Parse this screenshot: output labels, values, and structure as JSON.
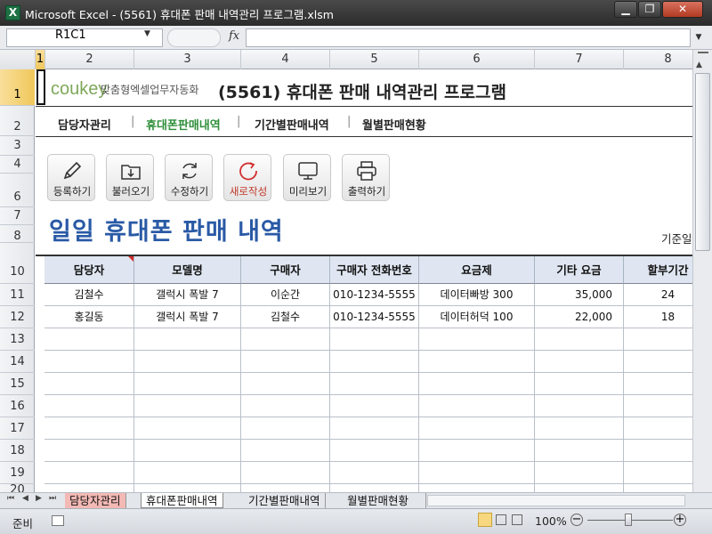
{
  "window": {
    "title": "Microsoft Excel - (5561) 휴대폰 판매 내역관리 프로그램.xlsm",
    "app_icon": "X",
    "minimize": "▁",
    "maximize": "❐",
    "close": "✕"
  },
  "formula_bar": {
    "name_box": "R1C1",
    "fx": "fx",
    "value": ""
  },
  "columns": [
    "1",
    "2",
    "3",
    "4",
    "5",
    "6",
    "7",
    "8"
  ],
  "rows": [
    "1",
    "2",
    "3",
    "4",
    "6",
    "7",
    "8",
    "10",
    "11",
    "12",
    "13",
    "14",
    "15",
    "16",
    "17",
    "18",
    "19",
    "20"
  ],
  "header": {
    "logo": "coukey",
    "tagline": "맞춤형엑셀업무자동화",
    "title": "(5561) 휴대폰 판매 내역관리 프로그램"
  },
  "nav": [
    "담당자관리",
    "휴대폰판매내역",
    "기간별판매내역",
    "월별판매현황"
  ],
  "nav_separator": "|",
  "toolbar": [
    {
      "label": "등록하기",
      "icon": "pencil-icon"
    },
    {
      "label": "불러오기",
      "icon": "folder-download-icon"
    },
    {
      "label": "수정하기",
      "icon": "refresh-icon"
    },
    {
      "label": "새로작성",
      "icon": "new-circle-icon"
    },
    {
      "label": "미리보기",
      "icon": "monitor-icon"
    },
    {
      "label": "출력하기",
      "icon": "printer-icon"
    }
  ],
  "section_title": "일일 휴대폰 판매 내역",
  "base_date_label": "기준일",
  "table": {
    "headers": [
      "담당자",
      "모델명",
      "구매자",
      "구매자 전화번호",
      "요금제",
      "기타 요금",
      "할부기간"
    ],
    "rows": [
      [
        "김철수",
        "갤럭시 폭발 7",
        "이순간",
        "010-1234-5555",
        "데이터빠방 300",
        "35,000",
        "24"
      ],
      [
        "홍길동",
        "갤럭시 폭발 7",
        "김철수",
        "010-1234-5555",
        "데이터허덕 100",
        "22,000",
        "18"
      ]
    ]
  },
  "sheet_tabs": [
    "담당자관리",
    "휴대폰판매내역",
    "기간별판매내역",
    "월별판매현황"
  ],
  "status": {
    "mode": "준비",
    "zoom": "100%"
  }
}
